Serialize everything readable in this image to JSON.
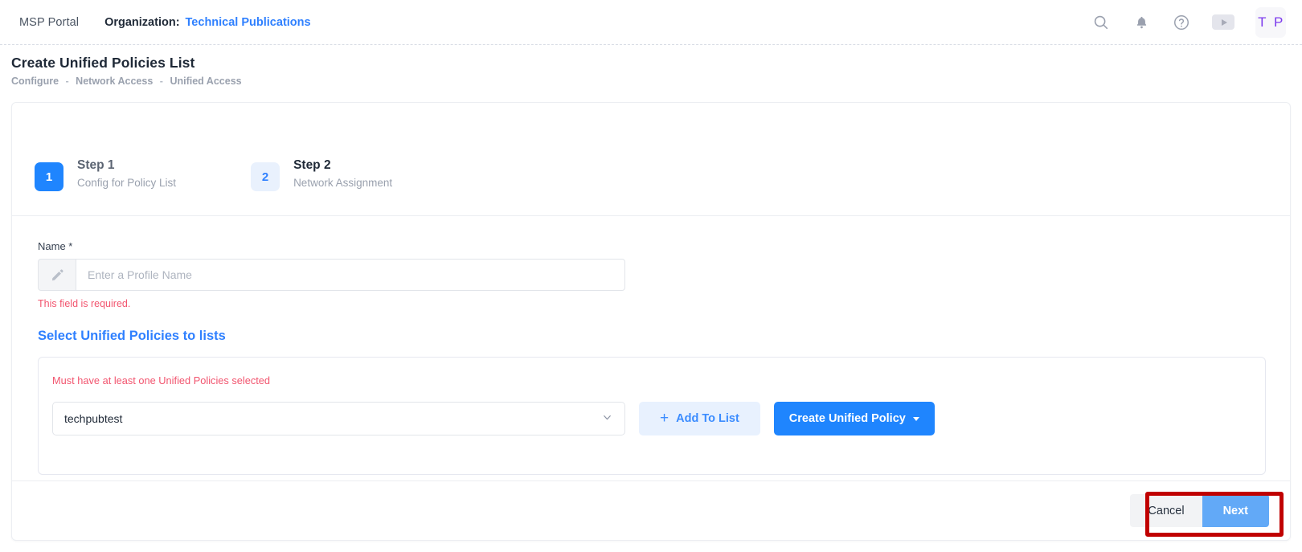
{
  "topbar": {
    "app_name": "MSP Portal",
    "organization_label": "Organization:",
    "organization_value": "Technical Publications",
    "icons": {
      "search": "search-icon",
      "notifications": "bell-icon",
      "help": "question-circle-icon",
      "video": "play-icon"
    },
    "avatar_initials": "T P"
  },
  "page": {
    "title": "Create Unified Policies List",
    "breadcrumb": [
      "Configure",
      "Network Access",
      "Unified Access"
    ],
    "breadcrumb_separator": "-"
  },
  "stepper": {
    "steps": [
      {
        "number": "1",
        "title": "Step 1",
        "subtitle": "Config for Policy List",
        "state": "active"
      },
      {
        "number": "2",
        "title": "Step 2",
        "subtitle": "Network Assignment",
        "state": "idle"
      }
    ]
  },
  "form": {
    "name_field": {
      "label": "Name *",
      "placeholder": "Enter a Profile Name",
      "value": "",
      "prefix_icon": "pencil-icon",
      "error": "This field is required."
    },
    "section_title": "Select Unified Policies to lists",
    "policy_card": {
      "error": "Must have at least one Unified Policies selected",
      "select_value": "techpubtest",
      "add_to_list_label": "Add To List",
      "create_policy_label": "Create Unified Policy"
    }
  },
  "footer": {
    "cancel_label": "Cancel",
    "next_label": "Next"
  },
  "colors": {
    "accent_blue": "#1f85fe",
    "link_blue": "#2f80ff",
    "error_red": "#f2556f",
    "avatar_purple": "#7c3aed",
    "highlight_red": "#c00000",
    "next_button_blue": "#62a9f7"
  }
}
